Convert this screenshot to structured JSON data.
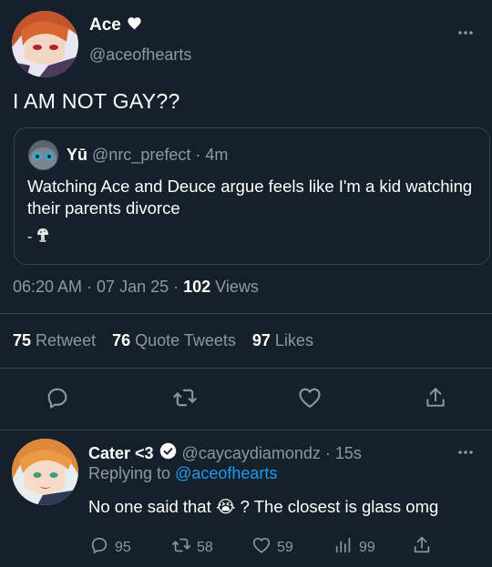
{
  "tweet": {
    "author_name": "Ace",
    "author_handle": "@aceofhearts",
    "text": "I AM NOT GAY??",
    "timestamp": "06:20 AM · 07 Jan 25 · ",
    "views_count": "102",
    "views_label": " Views",
    "retweet_count": "75",
    "retweet_label": "Retweet",
    "quote_count": "76",
    "quote_label": "Quote Tweets",
    "likes_count": "97",
    "likes_label": "Likes"
  },
  "quoted_tweet": {
    "name": "Yū",
    "handle_time": "@nrc_prefect · 4m",
    "text": "Watching Ace and Deuce argue feels like I'm a kid watching their parents divorce",
    "signature": "-"
  },
  "reply": {
    "name": "Cater <3",
    "handle_time": "@caycaydiamondz · 15s",
    "replying_prefix": "Replying to ",
    "replying_handle": "@aceofhearts",
    "text_before": "No one said that ",
    "text_emoji": "😭",
    "text_after": " ? The closest is glass omg",
    "reply_count": "95",
    "retweet_count": "58",
    "like_count": "59",
    "views_count": "99"
  },
  "icons": {
    "more": "more-icon",
    "heart_badge": "heart-icon",
    "verified": "verified-icon",
    "reply": "reply-icon",
    "retweet": "retweet-icon",
    "like": "like-icon",
    "share": "share-icon",
    "views": "views-icon"
  },
  "colors": {
    "background": "#15202b",
    "text": "#ffffff",
    "muted": "#8b98a5",
    "link": "#1d9bf0",
    "border": "#38444d"
  }
}
